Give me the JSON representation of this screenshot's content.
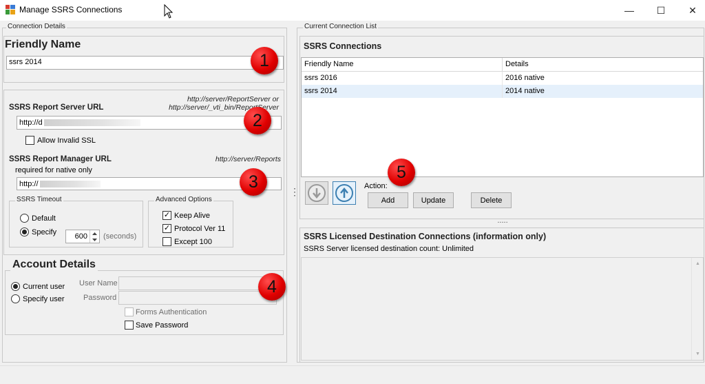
{
  "window": {
    "title": "Manage SSRS Connections",
    "minimize_glyph": "—",
    "maximize_glyph": "☐",
    "close_glyph": "✕"
  },
  "connection_details": {
    "legend": "Connection Details",
    "friendly_name": {
      "label": "Friendly Name",
      "value": "ssrs 2014"
    },
    "report_server": {
      "label": "SSRS Report Server URL",
      "hint_line1": "http://server/ReportServer or",
      "hint_line2": "http://server/_vti_bin/ReportServer",
      "value_prefix": "http://d",
      "allow_invalid_ssl_label": "Allow Invalid SSL"
    },
    "report_manager": {
      "label": "SSRS Report Manager URL",
      "hint": "http://server/Reports",
      "sublabel": "required for native only",
      "value_prefix": "http://"
    },
    "timeout": {
      "legend": "SSRS Timeout",
      "default_label": "Default",
      "specify_label": "Specify",
      "value": "600",
      "unit": "(seconds)"
    },
    "advanced": {
      "legend": "Advanced Options",
      "keep_alive": "Keep Alive",
      "protocol": "Protocol Ver 11",
      "except": "Except 100",
      "check_glyph": "✓"
    },
    "account": {
      "title": "Account Details",
      "current_user": "Current user",
      "specify_user": "Specify user",
      "username_label": "User Name",
      "password_label": "Password",
      "forms_auth": "Forms Authentication",
      "save_password": "Save Password"
    }
  },
  "connection_list": {
    "legend": "Current Connection List",
    "title": "SSRS Connections",
    "columns": [
      "Friendly Name",
      "Details"
    ],
    "rows": [
      {
        "name": "ssrs 2016",
        "details": "2016 native"
      },
      {
        "name": "ssrs 2014",
        "details": "2014 native"
      }
    ],
    "action_label": "Action:",
    "add": "Add",
    "update": "Update",
    "delete": "Delete",
    "splitter_dots": "....."
  },
  "licensed": {
    "title": "SSRS Licensed Destination Connections (information only)",
    "count_label": "SSRS Server licensed destination count:",
    "count_value": "Unlimited",
    "scroll_up": "▲",
    "scroll_down": "▼"
  },
  "annotations": [
    "1",
    "2",
    "3",
    "4",
    "5"
  ],
  "vertical_splitter": "⋮",
  "colors": {
    "badge_red": "#e00000",
    "selected_row": "#e5f0fb",
    "arrow_blue": "#3c7fb1"
  }
}
